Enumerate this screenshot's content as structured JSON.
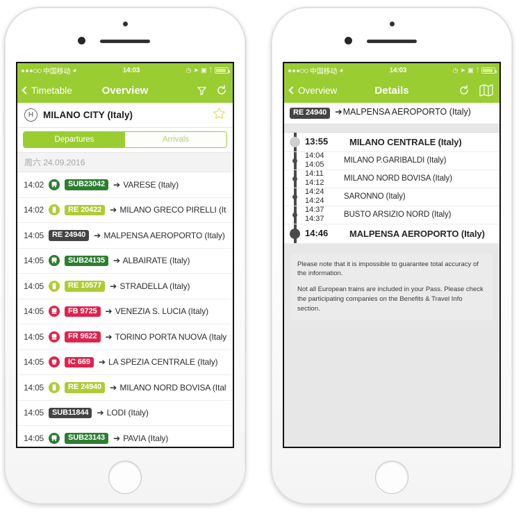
{
  "theme": {
    "accent_green": "#9ACD32",
    "badge_dark": "#444444",
    "badge_green_dark": "#2E7D32",
    "badge_olive": "#AFCB37",
    "badge_red": "#E0234E"
  },
  "status_bar": {
    "carrier": "中国移动",
    "wifi_icon": "wifi-icon",
    "time": "14:03",
    "icons": [
      "alarm-icon",
      "location-arrow-icon",
      "rotation-lock-icon",
      "bluetooth-icon",
      "battery-icon"
    ]
  },
  "overview": {
    "nav": {
      "back_label": "Timetable",
      "title": "Overview",
      "filter_icon": "filter-icon",
      "refresh_icon": "refresh-icon"
    },
    "station": {
      "marker": "H",
      "name": "MILANO CITY (Italy)",
      "favorite_icon": "star-outline-icon"
    },
    "segmented": {
      "departures_label": "Departures",
      "arrivals_label": "Arrivals",
      "selected": "Departures"
    },
    "date_header": "周六 24.09.2016",
    "departures": [
      {
        "time": "14:02",
        "type_icon": "tram-icon",
        "icon_color": "#2E7D32",
        "badge": "SUB23042",
        "badge_color": "#2E7D32",
        "destination": "VARESE (Italy)"
      },
      {
        "time": "14:02",
        "type_icon": "train-icon",
        "icon_color": "#AFCB37",
        "badge": "RE 20422",
        "badge_color": "#AFCB37",
        "destination": "MILANO GRECO PIRELLI (Italy)"
      },
      {
        "time": "14:05",
        "type_icon": "none",
        "icon_color": "",
        "badge": "RE 24940",
        "badge_color": "#444444",
        "destination": "MALPENSA AEROPORTO (Italy)"
      },
      {
        "time": "14:05",
        "type_icon": "tram-icon",
        "icon_color": "#2E7D32",
        "badge": "SUB24135",
        "badge_color": "#2E7D32",
        "destination": "ALBAIRATE (Italy)"
      },
      {
        "time": "14:05",
        "type_icon": "train-icon",
        "icon_color": "#AFCB37",
        "badge": "RE 10577",
        "badge_color": "#AFCB37",
        "destination": "STRADELLA (Italy)"
      },
      {
        "time": "14:05",
        "type_icon": "highspeed-icon",
        "icon_color": "#E0234E",
        "badge": "FB 9725",
        "badge_color": "#E0234E",
        "destination": "VENEZIA S. LUCIA (Italy)"
      },
      {
        "time": "14:05",
        "type_icon": "highspeed-icon",
        "icon_color": "#E0234E",
        "badge": "FR 9622",
        "badge_color": "#E0234E",
        "destination": "TORINO PORTA NUOVA (Italy)"
      },
      {
        "time": "14:05",
        "type_icon": "intercity-icon",
        "icon_color": "#E0234E",
        "badge": "IC 669",
        "badge_color": "#E0234E",
        "destination": "LA SPEZIA CENTRALE (Italy)"
      },
      {
        "time": "14:05",
        "type_icon": "train-icon",
        "icon_color": "#AFCB37",
        "badge": "RE 24940",
        "badge_color": "#AFCB37",
        "destination": "MILANO NORD BOVISA (Italy)"
      },
      {
        "time": "14:05",
        "type_icon": "none",
        "icon_color": "",
        "badge": "SUB11844",
        "badge_color": "#444444",
        "destination": "LODI (Italy)"
      },
      {
        "time": "14:05",
        "type_icon": "tram-icon",
        "icon_color": "#2E7D32",
        "badge": "SUB23143",
        "badge_color": "#2E7D32",
        "destination": "PAVIA (Italy)"
      }
    ]
  },
  "details": {
    "nav": {
      "back_label": "Overview",
      "title": "Details",
      "refresh_icon": "refresh-icon",
      "map_icon": "map-icon"
    },
    "header": {
      "badge": "RE 24940",
      "badge_color": "#444444",
      "destination": "MALPENSA AEROPORTO (Italy)"
    },
    "stops": [
      {
        "kind": "start",
        "arrival": "",
        "departure": "13:55",
        "name": "MILANO CENTRALE (Italy)"
      },
      {
        "kind": "middle",
        "arrival": "14:04",
        "departure": "14:05",
        "name": "MILANO P.GARIBALDI (Italy)"
      },
      {
        "kind": "middle",
        "arrival": "14:11",
        "departure": "14:12",
        "name": "MILANO NORD BOVISA (Italy)"
      },
      {
        "kind": "middle",
        "arrival": "14:24",
        "departure": "14:24",
        "name": "SARONNO (Italy)"
      },
      {
        "kind": "middle",
        "arrival": "14:37",
        "departure": "14:37",
        "name": "BUSTO ARSIZIO NORD (Italy)"
      },
      {
        "kind": "end",
        "arrival": "14:46",
        "departure": "",
        "name": "MALPENSA AEROPORTO (Italy)"
      }
    ],
    "notes": [
      "Please note that it is impossible to guarantee total accuracy of the information.",
      "Not all European trains are included in your Pass. Please check the participating companies on the Benefits & Travel Info section."
    ]
  }
}
